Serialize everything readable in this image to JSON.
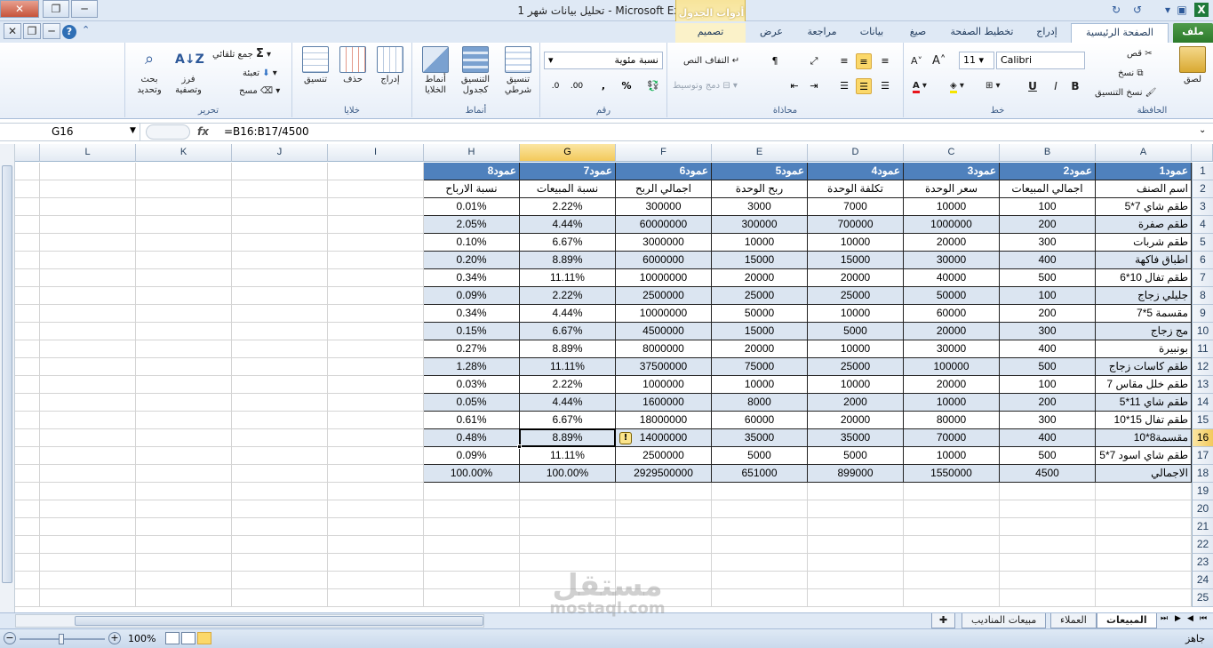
{
  "window": {
    "title": "تحليل بيانات شهر 1 - Microsoft Excel",
    "context_group": "أدوات الجدول"
  },
  "tabs": [
    "ملف",
    "الصفحة الرئيسية",
    "إدراج",
    "تخطيط الصفحة",
    "صيغ",
    "بيانات",
    "مراجعة",
    "عرض",
    "تصميم"
  ],
  "ribbon": {
    "clipboard": {
      "label": "الحافظة",
      "paste": "لصق",
      "cut": "قص",
      "copy": "نسخ",
      "format_painter": "نسخ التنسيق"
    },
    "font": {
      "label": "خط",
      "name": "Calibri",
      "size": "11",
      "bold": "B",
      "italic": "I",
      "underline": "U"
    },
    "alignment": {
      "label": "محاذاة",
      "wrap": "التفاف النص",
      "merge": "دمج وتوسيط"
    },
    "number": {
      "label": "رقم",
      "format": "نسبة مئوية",
      "percent": "%",
      "comma": ","
    },
    "styles": {
      "label": "أنماط",
      "conditional": "تنسيق شرطي",
      "as_table": "التنسيق كجدول",
      "cell_styles": "أنماط الخلايا"
    },
    "cells": {
      "label": "خلايا",
      "insert": "إدراج",
      "delete": "حذف",
      "format": "تنسيق"
    },
    "editing": {
      "label": "تحرير",
      "autosum": "جمع تلقائي",
      "fill": "تعبئة",
      "clear": "مسح",
      "sort": "فرز وتصفية",
      "find": "بحث وتحديد"
    }
  },
  "formula_bar": {
    "name_box": "G16",
    "fx": "fx",
    "formula": "=B16:B17/4500"
  },
  "columns": [
    "A",
    "B",
    "C",
    "D",
    "E",
    "F",
    "G",
    "H",
    "I",
    "J",
    "K",
    "L"
  ],
  "rows": [
    "1",
    "2",
    "3",
    "4",
    "5",
    "6",
    "7",
    "8",
    "9",
    "10",
    "11",
    "12",
    "13",
    "14",
    "15",
    "16",
    "17",
    "18",
    "19",
    "20",
    "21",
    "22",
    "23",
    "24",
    "25"
  ],
  "table": {
    "headers": [
      "عمود1",
      "عمود2",
      "عمود3",
      "عمود4",
      "عمود5",
      "عمود6",
      "عمود7",
      "عمود8"
    ],
    "subheaders": [
      "اسم الصنف",
      "اجمالي المبيعات",
      "سعر الوحدة",
      "تكلفة الوحدة",
      "ربح الوحدة",
      "اجمالي الربح",
      "نسبة المبيعات",
      "نسبة الارباح"
    ],
    "rows": [
      [
        "طقم شاي 7*5",
        "100",
        "10000",
        "7000",
        "3000",
        "300000",
        "2.22%",
        "0.01%"
      ],
      [
        "طقم صفرة",
        "200",
        "1000000",
        "700000",
        "300000",
        "60000000",
        "4.44%",
        "2.05%"
      ],
      [
        "طقم شربات",
        "300",
        "20000",
        "10000",
        "10000",
        "3000000",
        "6.67%",
        "0.10%"
      ],
      [
        "اطباق فاكهة",
        "400",
        "30000",
        "15000",
        "15000",
        "6000000",
        "8.89%",
        "0.20%"
      ],
      [
        "طقم تفال 10*6",
        "500",
        "40000",
        "20000",
        "20000",
        "10000000",
        "11.11%",
        "0.34%"
      ],
      [
        "جليلي زجاج",
        "100",
        "50000",
        "25000",
        "25000",
        "2500000",
        "2.22%",
        "0.09%"
      ],
      [
        "مقسمة 5*7",
        "200",
        "60000",
        "10000",
        "50000",
        "10000000",
        "4.44%",
        "0.34%"
      ],
      [
        "مج زجاج",
        "300",
        "20000",
        "5000",
        "15000",
        "4500000",
        "6.67%",
        "0.15%"
      ],
      [
        "بونبيرة",
        "400",
        "30000",
        "10000",
        "20000",
        "8000000",
        "8.89%",
        "0.27%"
      ],
      [
        "طقم كاسات زجاج",
        "500",
        "100000",
        "25000",
        "75000",
        "37500000",
        "11.11%",
        "1.28%"
      ],
      [
        "طقم خلل مقاس 7",
        "100",
        "20000",
        "10000",
        "10000",
        "1000000",
        "2.22%",
        "0.03%"
      ],
      [
        "طقم شاي 11*5",
        "200",
        "10000",
        "2000",
        "8000",
        "1600000",
        "4.44%",
        "0.05%"
      ],
      [
        "طقم تفال 15*10",
        "300",
        "80000",
        "20000",
        "60000",
        "18000000",
        "6.67%",
        "0.61%"
      ],
      [
        "مقسمة8*10",
        "400",
        "70000",
        "35000",
        "35000",
        "14000000",
        "8.89%",
        "0.48%"
      ],
      [
        "طقم شاي اسود 7*5",
        "500",
        "10000",
        "5000",
        "5000",
        "2500000",
        "11.11%",
        "0.09%"
      ]
    ],
    "total": [
      "الاجمالي",
      "4500",
      "1550000",
      "899000",
      "651000",
      "2929500000",
      "100.00%",
      "100.00%"
    ]
  },
  "sheets": [
    "المبيعات",
    "العملاء",
    "مبيعات المناديب"
  ],
  "status": {
    "ready": "جاهز",
    "zoom": "100%"
  },
  "watermark": {
    "arabic": "مستقل",
    "latin": "mostaql.com"
  }
}
